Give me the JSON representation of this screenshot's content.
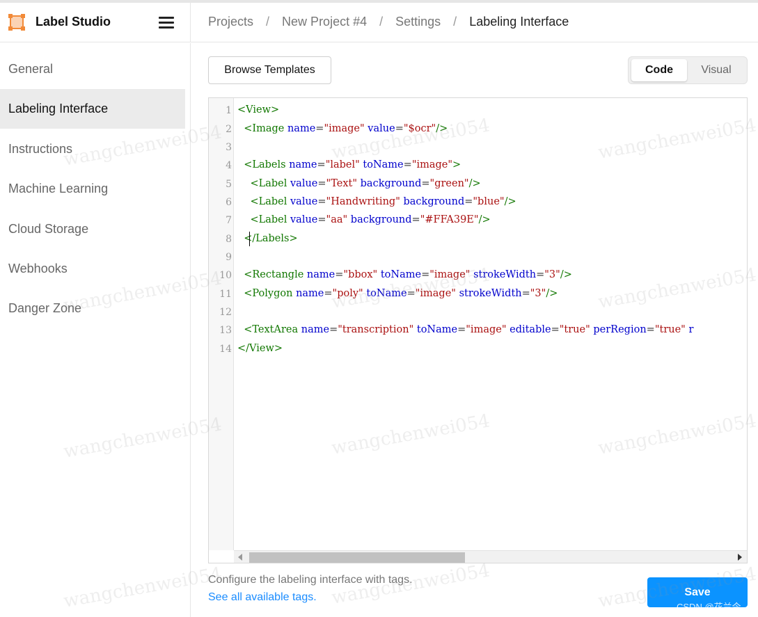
{
  "app": {
    "name": "Label Studio"
  },
  "header": {
    "breadcrumb": [
      {
        "label": "Projects"
      },
      {
        "label": "New Project #4"
      },
      {
        "label": "Settings"
      },
      {
        "label": "Labeling Interface"
      }
    ]
  },
  "sidebar": {
    "items": [
      {
        "label": "General"
      },
      {
        "label": "Labeling Interface"
      },
      {
        "label": "Instructions"
      },
      {
        "label": "Machine Learning"
      },
      {
        "label": "Cloud Storage"
      },
      {
        "label": "Webhooks"
      },
      {
        "label": "Danger Zone"
      }
    ],
    "active_index": 1
  },
  "toolbar": {
    "browse_label": "Browse Templates",
    "mode_code": "Code",
    "mode_visual": "Visual",
    "active_mode": "Code"
  },
  "editor": {
    "line_numbers": [
      "1",
      "2",
      "3",
      "4",
      "5",
      "6",
      "7",
      "8",
      "9",
      "10",
      "11",
      "12",
      "13",
      "14"
    ],
    "lines": [
      "<View>",
      "  <Image name=\"image\" value=\"$ocr\"/>",
      "",
      "  <Labels name=\"label\" toName=\"image\">",
      "    <Label value=\"Text\" background=\"green\"/>",
      "    <Label value=\"Handwriting\" background=\"blue\"/>",
      "    <Label value=\"aa\" background=\"#FFA39E\"/>",
      "  </Labels>",
      "",
      "  <Rectangle name=\"bbox\" toName=\"image\" strokeWidth=\"3\"/>",
      "  <Polygon name=\"poly\" toName=\"image\" strokeWidth=\"3\"/>",
      "",
      "  <TextArea name=\"transcription\" toName=\"image\" editable=\"true\" perRegion=\"true\" r",
      "</View>"
    ]
  },
  "footer": {
    "hint": "Configure the labeling interface with tags.",
    "link": "See all available tags.",
    "save_label": "Save"
  },
  "watermark": {
    "text": "wangchenwei054",
    "credit": "CSDN @花兰今"
  },
  "colors": {
    "accent": "#0b93ff",
    "logo": "#f28a38",
    "tag": "#117700",
    "attr": "#0000cc",
    "string": "#aa1111"
  }
}
